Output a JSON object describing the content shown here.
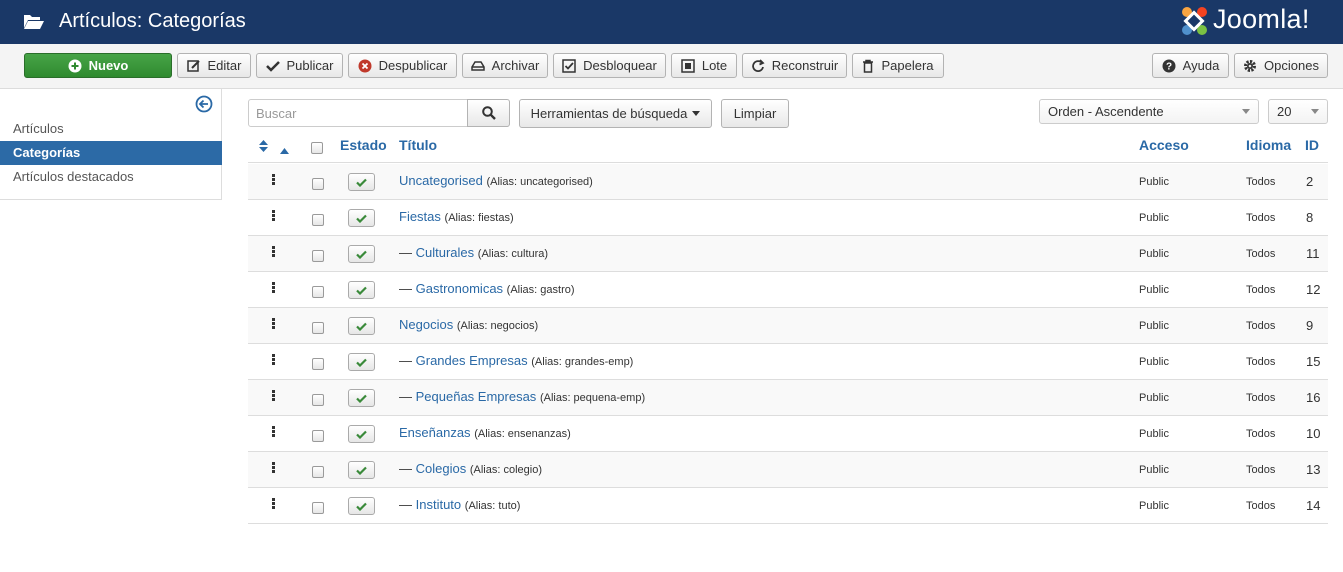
{
  "header": {
    "title": "Artículos: Categorías",
    "logo_text": "Joomla!"
  },
  "toolbar": {
    "new": "Nuevo",
    "edit": "Editar",
    "publish": "Publicar",
    "unpublish": "Despublicar",
    "archive": "Archivar",
    "checkin": "Desbloquear",
    "batch": "Lote",
    "rebuild": "Reconstruir",
    "trash": "Papelera",
    "help": "Ayuda",
    "options": "Opciones"
  },
  "sidebar": {
    "items": [
      {
        "label": "Artículos"
      },
      {
        "label": "Categorías"
      },
      {
        "label": "Artículos destacados"
      }
    ]
  },
  "filters": {
    "search_placeholder": "Buscar",
    "search_tools": "Herramientas de búsqueda",
    "clear": "Limpiar",
    "ordering": "Orden - Ascendente",
    "limit": "20"
  },
  "table": {
    "headers": {
      "status": "Estado",
      "title": "Título",
      "access": "Acceso",
      "language": "Idioma",
      "id": "ID"
    },
    "rows": [
      {
        "prefix": "",
        "title": "Uncategorised",
        "alias": "(Alias: uncategorised)",
        "access": "Public",
        "language": "Todos",
        "id": "2"
      },
      {
        "prefix": "",
        "title": "Fiestas",
        "alias": "(Alias: fiestas)",
        "access": "Public",
        "language": "Todos",
        "id": "8"
      },
      {
        "prefix": "— ",
        "title": "Culturales",
        "alias": "(Alias: cultura)",
        "access": "Public",
        "language": "Todos",
        "id": "11"
      },
      {
        "prefix": "— ",
        "title": "Gastronomicas",
        "alias": "(Alias: gastro)",
        "access": "Public",
        "language": "Todos",
        "id": "12"
      },
      {
        "prefix": "",
        "title": "Negocios",
        "alias": "(Alias: negocios)",
        "access": "Public",
        "language": "Todos",
        "id": "9"
      },
      {
        "prefix": "— ",
        "title": "Grandes Empresas",
        "alias": "(Alias: grandes-emp)",
        "access": "Public",
        "language": "Todos",
        "id": "15"
      },
      {
        "prefix": "— ",
        "title": "Pequeñas Empresas",
        "alias": "(Alias: pequena-emp)",
        "access": "Public",
        "language": "Todos",
        "id": "16"
      },
      {
        "prefix": "",
        "title": "Enseñanzas",
        "alias": "(Alias: ensenanzas)",
        "access": "Public",
        "language": "Todos",
        "id": "10"
      },
      {
        "prefix": "— ",
        "title": "Colegios",
        "alias": "(Alias: colegio)",
        "access": "Public",
        "language": "Todos",
        "id": "13"
      },
      {
        "prefix": "— ",
        "title": "Instituto",
        "alias": "(Alias: tuto)",
        "access": "Public",
        "language": "Todos",
        "id": "14"
      }
    ]
  },
  "colors": {
    "header_bg": "#1a3867",
    "link": "#2a69a6",
    "active_nav": "#2c6aa6",
    "new_button": "#3c9a3c"
  }
}
